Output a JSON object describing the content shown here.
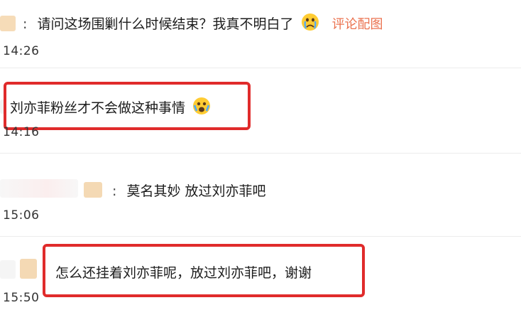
{
  "comments": [
    {
      "separator": ":",
      "text": "请问这场围剿什么时候结束？我真不明白了",
      "emoji": "crying-face-emoji",
      "link_label": "评论配图",
      "time": "14:26"
    },
    {
      "separator": ":",
      "text": "刘亦菲粉丝才不会做这种事情",
      "emoji": "anguished-face-emoji",
      "time": "14:16"
    },
    {
      "separator": ":",
      "text": "莫名其妙 放过刘亦菲吧",
      "time": "15:06"
    },
    {
      "text": "怎么还挂着刘亦菲呢，放过刘亦菲吧，谢谢",
      "time": "15:50"
    }
  ],
  "colors": {
    "highlight": "#e02b2b",
    "link": "#eb7350",
    "blur_avatar": "#f4d9b4"
  }
}
